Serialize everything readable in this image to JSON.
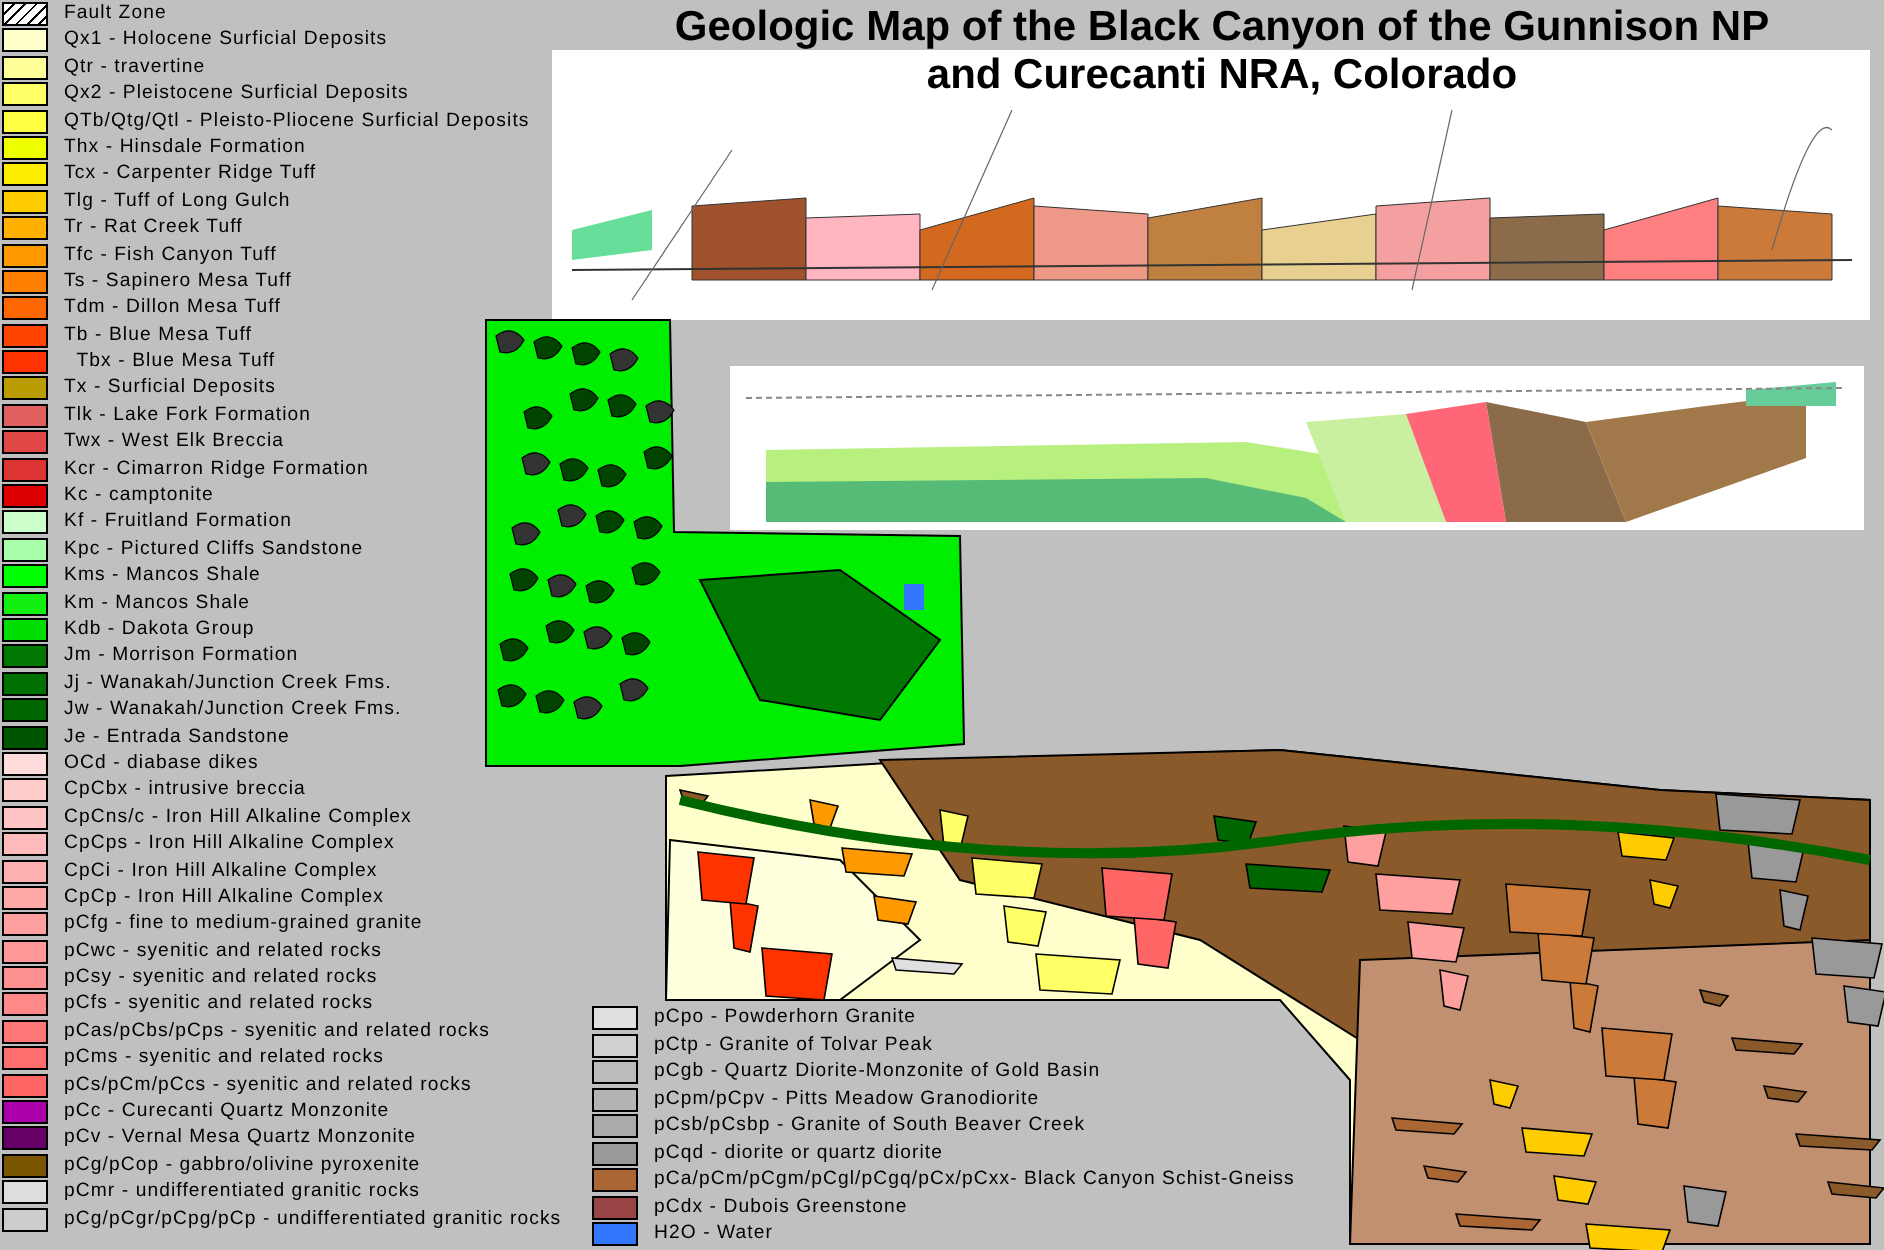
{
  "title": {
    "line_1": "Geologic Map of the Black Canyon of the Gunnison NP",
    "line_2": "and Curecanti NRA, Colorado"
  },
  "legend": [
    {
      "kind": "hatch",
      "color": "#ffffff",
      "label": "Fault Zone"
    },
    {
      "kind": "solid",
      "color": "#ffffcc",
      "label": "Qx1 - Holocene Surficial Deposits"
    },
    {
      "kind": "solid",
      "color": "#ffff99",
      "label": "Qtr - travertine"
    },
    {
      "kind": "solid",
      "color": "#ffff66",
      "label": "Qx2 - Pleistocene Surficial Deposits"
    },
    {
      "kind": "solid",
      "color": "#ffff44",
      "label": "QTb/Qtg/Qtl - Pleisto-Pliocene Surficial Deposits"
    },
    {
      "kind": "solid",
      "color": "#eeff00",
      "label": "Thx - Hinsdale Formation"
    },
    {
      "kind": "solid",
      "color": "#ffee00",
      "label": "Tcx - Carpenter Ridge Tuff"
    },
    {
      "kind": "solid",
      "color": "#ffcc00",
      "label": "Tlg - Tuff of Long Gulch"
    },
    {
      "kind": "solid",
      "color": "#ffb000",
      "label": "Tr - Rat Creek Tuff"
    },
    {
      "kind": "solid",
      "color": "#ff9900",
      "label": "Tfc - Fish Canyon Tuff"
    },
    {
      "kind": "solid",
      "color": "#ff7f00",
      "label": "Ts - Sapinero Mesa Tuff"
    },
    {
      "kind": "solid",
      "color": "#ff6600",
      "label": "Tdm - Dillon Mesa Tuff"
    },
    {
      "kind": "solid",
      "color": "#ff4400",
      "label": "Tb - Blue Mesa Tuff"
    },
    {
      "kind": "solid",
      "color": "#ff3300",
      "label": "  Tbx - Blue Mesa Tuff"
    },
    {
      "kind": "solid",
      "color": "#b89c00",
      "label": "Tx - Surficial Deposits"
    },
    {
      "kind": "solid",
      "color": "#e06060",
      "label": "Tlk - Lake Fork Formation"
    },
    {
      "kind": "solid",
      "color": "#e04848",
      "label": "Twx - West Elk Breccia"
    },
    {
      "kind": "solid",
      "color": "#dd3333",
      "label": "Kcr - Cimarron Ridge Formation"
    },
    {
      "kind": "solid",
      "color": "#dd0000",
      "label": "Kc - camptonite"
    },
    {
      "kind": "solid",
      "color": "#ccffcc",
      "label": "Kf - Fruitland Formation"
    },
    {
      "kind": "solid",
      "color": "#aaffaa",
      "label": "Kpc - Pictured Cliffs Sandstone"
    },
    {
      "kind": "solid",
      "color": "#00ff00",
      "label": "Kms - Mancos Shale"
    },
    {
      "kind": "solid",
      "color": "#11f011",
      "label": "Km - Mancos Shale"
    },
    {
      "kind": "solid",
      "color": "#00dd00",
      "label": "Kdb - Dakota Group"
    },
    {
      "kind": "solid",
      "color": "#007700",
      "label": "Jm - Morrison Formation"
    },
    {
      "kind": "solid",
      "color": "#007000",
      "label": "Jj - Wanakah/Junction Creek Fms."
    },
    {
      "kind": "solid",
      "color": "#006600",
      "label": "Jw - Wanakah/Junction Creek Fms."
    },
    {
      "kind": "solid",
      "color": "#005500",
      "label": "Je - Entrada Sandstone"
    },
    {
      "kind": "solid",
      "color": "#ffdddd",
      "label": "OCd - diabase dikes"
    },
    {
      "kind": "solid",
      "color": "#ffcccc",
      "label": "CpCbx - intrusive breccia"
    },
    {
      "kind": "solid",
      "color": "#ffc4c4",
      "label": "CpCns/c - Iron Hill Alkaline Complex"
    },
    {
      "kind": "solid",
      "color": "#ffbbbb",
      "label": "CpCps - Iron Hill Alkaline Complex"
    },
    {
      "kind": "solid",
      "color": "#ffb0b0",
      "label": "CpCi - Iron Hill Alkaline Complex"
    },
    {
      "kind": "solid",
      "color": "#ffa8a8",
      "label": "CpCp - Iron Hill Alkaline Complex"
    },
    {
      "kind": "solid",
      "color": "#ffa0a0",
      "label": "pCfg - fine to medium-grained granite"
    },
    {
      "kind": "solid",
      "color": "#ff9999",
      "label": "pCwc - syenitic and related rocks"
    },
    {
      "kind": "solid",
      "color": "#ff9090",
      "label": "pCsy - syenitic and related rocks"
    },
    {
      "kind": "solid",
      "color": "#ff8888",
      "label": "pCfs - syenitic and related rocks"
    },
    {
      "kind": "solid",
      "color": "#ff7777",
      "label": "pCas/pCbs/pCps - syenitic and related rocks"
    },
    {
      "kind": "solid",
      "color": "#ff6e6e",
      "label": "pCms - syenitic and related rocks"
    },
    {
      "kind": "solid",
      "color": "#ff6666",
      "label": "pCs/pCm/pCcs - syenitic and related rocks"
    },
    {
      "kind": "solid",
      "color": "#aa00aa",
      "label": "pCc - Curecanti Quartz Monzonite"
    },
    {
      "kind": "solid",
      "color": "#660066",
      "label": "pCv - Vernal Mesa Quartz Monzonite"
    },
    {
      "kind": "solid",
      "color": "#7a5500",
      "label": "pCg/pCop - gabbro/olivine pyroxenite"
    },
    {
      "kind": "solid",
      "color": "#dddddd",
      "label": "pCmr - undifferentiated granitic rocks"
    },
    {
      "kind": "solid",
      "color": "#cccccc",
      "label": "pCg/pCgr/pCpg/pCp - undifferentiated granitic rocks"
    }
  ],
  "legend_2": [
    {
      "color": "#e0e0e0",
      "label": "pCpo - Powderhorn Granite"
    },
    {
      "color": "#d0d0d0",
      "label": "pCtp - Granite of Tolvar Peak"
    },
    {
      "color": "#bbbbbb",
      "label": "pCgb - Quartz Diorite-Monzonite of Gold Basin"
    },
    {
      "color": "#b4b4b4",
      "label": "pCpm/pCpv - Pitts Meadow Granodiorite"
    },
    {
      "color": "#aaaaaa",
      "label": "pCsb/pCsbp - Granite of South Beaver Creek"
    },
    {
      "color": "#999999",
      "label": "pCqd - diorite or quartz diorite"
    },
    {
      "color": "#aa6633",
      "label": "pCa/pCm/pCgm/pCgl/pCgq/pCx/pCxx- Black Canyon Schist-Gneiss"
    },
    {
      "color": "#994444",
      "label": "pCdx - Dubois Greenstone"
    },
    {
      "color": "#3377ff",
      "label": "H2O - Water"
    }
  ]
}
